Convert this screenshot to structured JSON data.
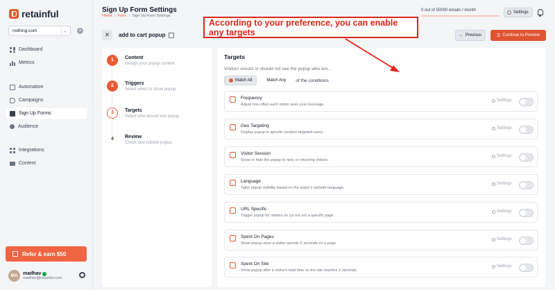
{
  "sidebar": {
    "brand": "retainful",
    "site": "nothing.com",
    "items": [
      {
        "label": "Dashboard",
        "icon": "dashboard-icon"
      },
      {
        "label": "Metrics",
        "icon": "metrics-icon"
      },
      {
        "label": "Automation",
        "icon": "automation-icon"
      },
      {
        "label": "Campaigns",
        "icon": "campaigns-icon"
      },
      {
        "label": "Sign Up Forms",
        "icon": "signup-forms-icon",
        "active": true
      },
      {
        "label": "Audience",
        "icon": "audience-icon"
      },
      {
        "label": "Integrations",
        "icon": "integrations-icon"
      },
      {
        "label": "Content",
        "icon": "content-icon"
      }
    ],
    "refer_label": "Refer & earn $50",
    "user": {
      "initials": "MA",
      "name": "madhav",
      "email": "madhav@retainful.com"
    }
  },
  "header": {
    "title": "Sign Up Form Settings",
    "breadcrumb": [
      "Home",
      "Form",
      "Sign Up Form Settings"
    ],
    "usage_text": "0 out of 50000 emails / month",
    "usage_fraction": 0,
    "settings_label": "Settings"
  },
  "subheader": {
    "popup_name": "add to cart popup",
    "prev_label": "Previous",
    "next_label": "Continue to Preview"
  },
  "steps": [
    {
      "num": "1",
      "title": "Content",
      "desc": "Design your popup content",
      "state": "done"
    },
    {
      "num": "2",
      "title": "Triggers",
      "desc": "Select when to show popup",
      "state": "done"
    },
    {
      "num": "3",
      "title": "Targets",
      "desc": "Select who should see popup",
      "state": "current"
    },
    {
      "num": "4",
      "title": "Review",
      "desc": "Check and publish popup",
      "state": "todo"
    }
  ],
  "targets_panel": {
    "title": "Targets",
    "subtitle": "Visitors should or should not see the popup who are...",
    "match_all": "Match All",
    "match_any": "Match Any",
    "conditions_text": "of the conditions",
    "setting_label": "Settings",
    "items": [
      {
        "name": "Frequency",
        "desc": "Adjust how often each visitor sees your message.",
        "icon": "frequency-icon"
      },
      {
        "name": "Geo Targeting",
        "desc": "Display popup to specific location targeted users.",
        "icon": "geo-icon"
      },
      {
        "name": "Visitor Session",
        "desc": "Show or hide the popup to new, or returning visitors.",
        "icon": "cart-icon"
      },
      {
        "name": "Language",
        "desc": "Tailor popup visibility based on the visitor's website language.",
        "icon": "language-icon"
      },
      {
        "name": "URL Specific",
        "desc": "Trigger popup for visitors on (or not on) a specific page.",
        "icon": "url-icon"
      },
      {
        "name": "Spent On Pages",
        "desc": "Show popup once a visitor spends X seconds on a page.",
        "icon": "pages-time-icon"
      },
      {
        "name": "Spent On Site",
        "desc": "Show popup after a visitor's total time on the site reaches X seconds.",
        "icon": "site-time-icon"
      }
    ]
  },
  "annotation": {
    "line1": "According to your preference, you can enable",
    "line2": "any targets"
  },
  "colors": {
    "accent": "#ea5a35",
    "annotation": "#e0241b"
  }
}
